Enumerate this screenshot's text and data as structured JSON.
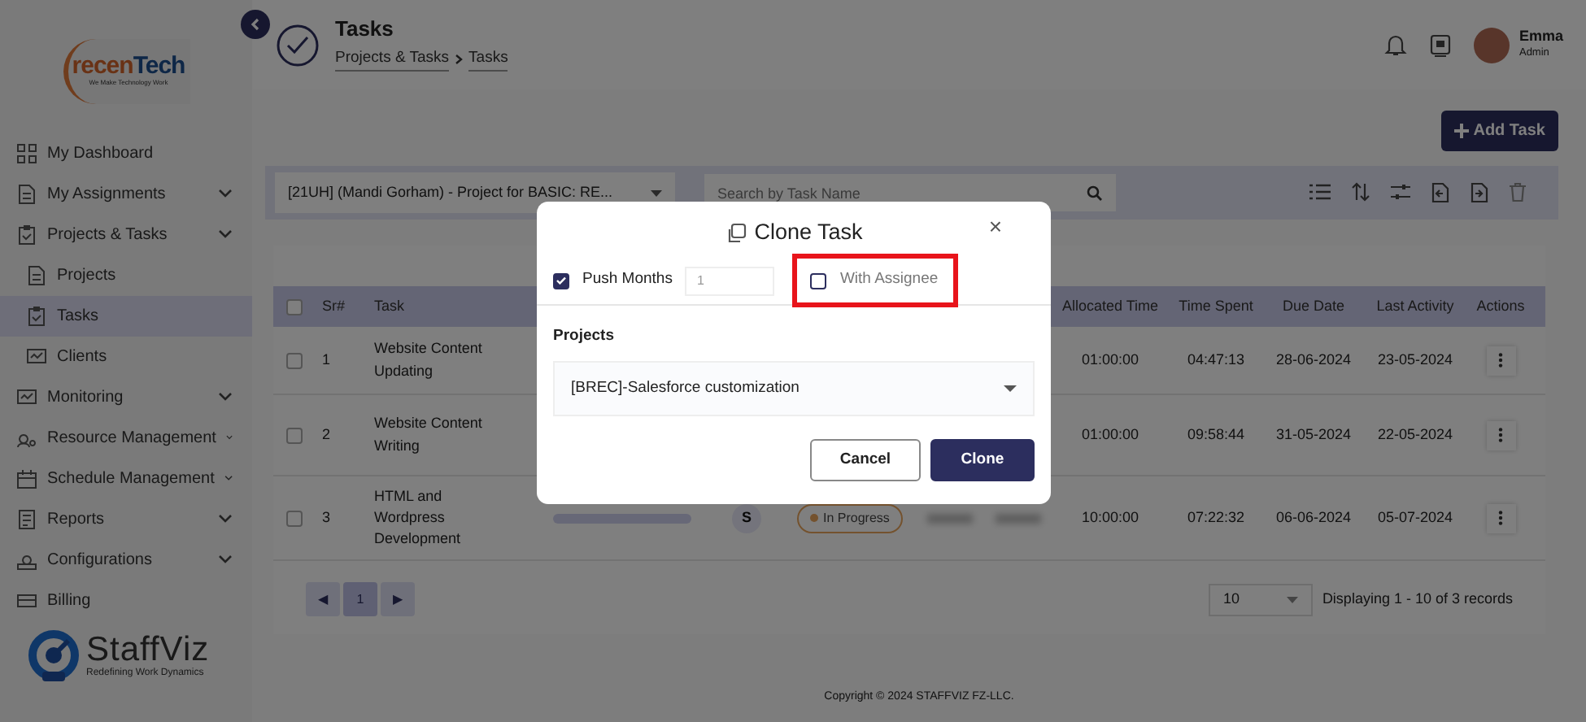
{
  "sidebar": {
    "logo": {
      "name": "recenTech",
      "tagline": "We Make Technology Work"
    },
    "items": [
      {
        "label": "My Dashboard",
        "expandable": false,
        "selected": false
      },
      {
        "label": "My Assignments",
        "expandable": true,
        "selected": false
      },
      {
        "label": "Projects & Tasks",
        "expandable": true,
        "selected": false,
        "children": [
          {
            "label": "Projects",
            "selected": false
          },
          {
            "label": "Tasks",
            "selected": true
          },
          {
            "label": "Clients",
            "selected": false
          }
        ]
      },
      {
        "label": "Monitoring",
        "expandable": true,
        "selected": false
      },
      {
        "label": "Resource Management",
        "expandable": true,
        "selected": false
      },
      {
        "label": "Schedule Management",
        "expandable": true,
        "selected": false
      },
      {
        "label": "Reports",
        "expandable": true,
        "selected": false
      },
      {
        "label": "Configurations",
        "expandable": true,
        "selected": false
      },
      {
        "label": "Billing",
        "expandable": false,
        "selected": false
      }
    ],
    "brand": {
      "name": "StaffViz",
      "tagline": "Redefining Work Dynamics"
    }
  },
  "header": {
    "title": "Tasks",
    "breadcrumb": [
      "Projects & Tasks",
      "Tasks"
    ],
    "user": {
      "name": "Emma",
      "role": "Admin"
    }
  },
  "toolbar": {
    "add_button": "Add Task",
    "project_filter": "[21UH] (Mandi Gorham) - Project for BASIC: RE...",
    "search": {
      "placeholder": "Search by Task Name"
    }
  },
  "table": {
    "select_all": {
      "checked": false
    },
    "columns": [
      "Sr#",
      "Task",
      "Allocated Time",
      "Time Spent",
      "Due Date",
      "Last Activity",
      "Actions"
    ],
    "rows": [
      {
        "checked": false,
        "sr": "1",
        "task": "Website Content Updating",
        "allocated": "01:00:00",
        "spent": "04:47:13",
        "due": "28-06-2024",
        "last_activity": "23-05-2024"
      },
      {
        "checked": false,
        "sr": "2",
        "task": "Website Content Writing",
        "allocated": "01:00:00",
        "spent": "09:58:44",
        "due": "31-05-2024",
        "last_activity": "22-05-2024"
      },
      {
        "checked": false,
        "sr": "3",
        "task": "HTML and Wordpress Development",
        "progress": {
          "level": 0
        },
        "assignee": "S",
        "status": "In Progress",
        "amounts_blurred": true,
        "allocated": "10:00:00",
        "spent": "07:22:32",
        "due": "06-06-2024",
        "last_activity": "05-07-2024"
      }
    ]
  },
  "pagination": {
    "prev": "◀",
    "pages": [
      {
        "label": "1",
        "selected": true
      }
    ],
    "next": "▶",
    "page_size": "10",
    "summary": "Displaying 1 - 10 of 3 records"
  },
  "footer": "Copyright © 2024 STAFFVIZ FZ-LLC.",
  "modal": {
    "title": "Clone Task",
    "close": "×",
    "push_months": {
      "label": "Push Months",
      "checked": true,
      "value": "1"
    },
    "with_assignee": {
      "label": "With Assignee",
      "checked": false,
      "highlighted": true
    },
    "projects": {
      "label": "Projects",
      "value": "[BREC]-Salesforce customization"
    },
    "buttons": [
      {
        "label": "Cancel",
        "kind": "secondary"
      },
      {
        "label": "Clone",
        "kind": "primary"
      }
    ]
  }
}
